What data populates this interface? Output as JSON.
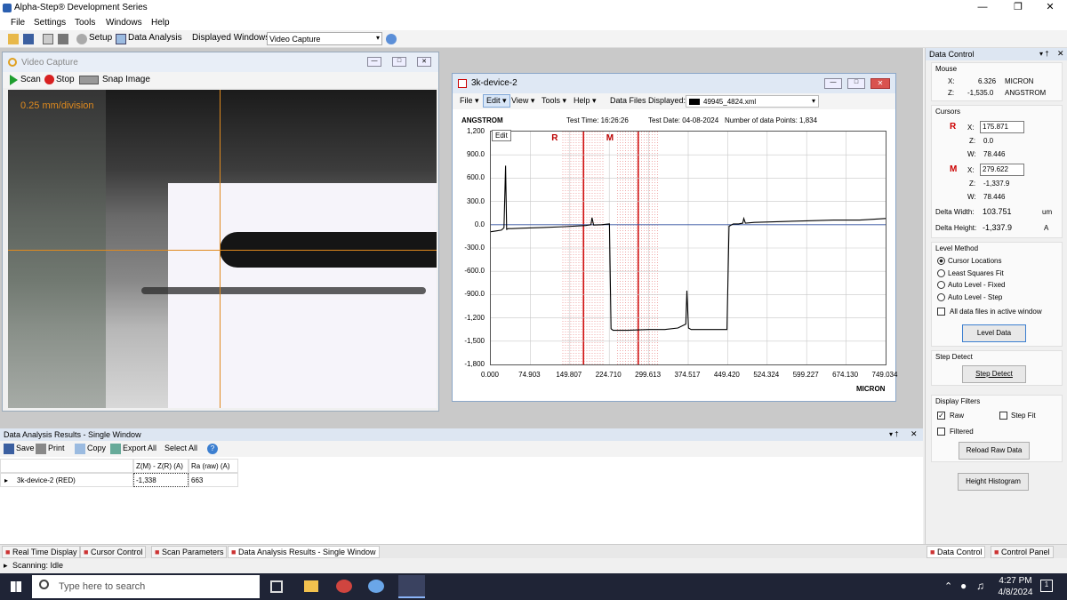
{
  "app": {
    "title": "Alpha-Step® Development Series",
    "menu": [
      "File",
      "Settings",
      "Tools",
      "Windows",
      "Help"
    ]
  },
  "toolbar": {
    "setup": "Setup",
    "data_analysis": "Data Analysis",
    "displayed_windows_label": "Displayed Windows:",
    "displayed_windows_value": "Video Capture"
  },
  "video": {
    "title": "Video Capture",
    "scan": "Scan",
    "stop": "Stop",
    "snap": "Snap Image",
    "scale": "0.25 mm/division"
  },
  "graph": {
    "title": "3k-device-2",
    "menu": [
      "File",
      "Edit",
      "View",
      "Tools",
      "Help"
    ],
    "data_files_label": "Data Files Displayed:",
    "data_file": "49945_4824.xml",
    "y_unit": "ANGSTROM",
    "test_time": "Test Time: 16:26:26",
    "test_date": "Test Date: 04-08-2024",
    "num_points": "Number of data Points: 1,834",
    "tooltip": "Edit",
    "cursor_r_label": "R",
    "cursor_m_label": "M",
    "x_unit": "MICRON"
  },
  "chart_data": {
    "type": "line",
    "xlabel": "MICRON",
    "ylabel": "ANGSTROM",
    "xlim": [
      0,
      749.034
    ],
    "ylim": [
      -1800,
      1200
    ],
    "x_ticks": [
      "0.000",
      "74.903",
      "149.807",
      "224.710",
      "299.613",
      "374.517",
      "449.420",
      "524.324",
      "599.227",
      "674.130",
      "749.034"
    ],
    "y_ticks": [
      "1,200",
      "900.0",
      "600.0",
      "300.0",
      "0.0",
      "-300.0",
      "-600.0",
      "-900.0",
      "-1,200",
      "-1,500",
      "-1,800"
    ],
    "cursors": [
      {
        "name": "R",
        "x": 175.871,
        "width": 78.446
      },
      {
        "name": "M",
        "x": 279.622,
        "width": 78.446
      }
    ],
    "series": [
      {
        "x": [
          0,
          10,
          20,
          25,
          28,
          30,
          33,
          40,
          60,
          100,
          140,
          180,
          190,
          192,
          195,
          210,
          225,
          228,
          232,
          240,
          260,
          300,
          330,
          355,
          370,
          372,
          375,
          380,
          400,
          430,
          448,
          452,
          460,
          470,
          478,
          480,
          483,
          500,
          550,
          600,
          650,
          700,
          749
        ],
        "y": [
          -90,
          -80,
          -70,
          -40,
          760,
          -60,
          -50,
          -50,
          -45,
          -35,
          -25,
          -10,
          0,
          90,
          -5,
          0,
          10,
          -1340,
          -1360,
          -1360,
          -1360,
          -1350,
          -1350,
          -1330,
          -1280,
          -850,
          -1330,
          -1350,
          -1350,
          -1350,
          -1350,
          -20,
          10,
          10,
          20,
          80,
          20,
          30,
          40,
          50,
          60,
          60,
          80
        ]
      }
    ]
  },
  "data_control": {
    "title": "Data Control",
    "mouse": {
      "label": "Mouse",
      "x_label": "X:",
      "x": "6.326",
      "x_unit": "MICRON",
      "z_label": "Z:",
      "z": "-1,535.0",
      "z_unit": "ANGSTROM"
    },
    "cursors_label": "Cursors",
    "r": {
      "label": "R",
      "x_label": "X:",
      "x": "175.871",
      "z_label": "Z:",
      "z": "0.0",
      "w_label": "W:",
      "w": "78.446"
    },
    "m": {
      "label": "M",
      "x_label": "X:",
      "x": "279.622",
      "z_label": "Z:",
      "z": "-1,337.9",
      "w_label": "W:",
      "w": "78.446"
    },
    "delta_width_label": "Delta Width:",
    "delta_width": "103.751",
    "delta_width_unit": "um",
    "delta_height_label": "Delta Height:",
    "delta_height": "-1,337.9",
    "delta_height_unit": "A",
    "level_method_label": "Level Method",
    "level_methods": [
      "Cursor Locations",
      "Least Squares Fit",
      "Auto Level - Fixed",
      "Auto Level - Step"
    ],
    "all_files": "All data files in active window",
    "level_data": "Level Data",
    "step_detect_label": "Step Detect",
    "step_detect": "Step Detect",
    "display_filters_label": "Display Filters",
    "raw": "Raw",
    "step_fit": "Step Fit",
    "filtered": "Filtered",
    "reload": "Reload Raw Data",
    "histogram": "Height Histogram"
  },
  "results": {
    "title": "Data Analysis Results - Single Window",
    "save": "Save",
    "print": "Print",
    "copy": "Copy",
    "export_all": "Export All",
    "select_all": "Select All",
    "col1": "Z(M) - Z(R) (A)",
    "col2": "Ra (raw) (A)",
    "row_name": "3k-device-2 (RED)",
    "row_v1": "-1,338",
    "row_v2": "663"
  },
  "tabs": {
    "bottom": [
      "Real Time Display",
      "Cursor Control",
      "Scan Parameters",
      "Data Analysis Results - Single Window"
    ],
    "right": [
      "Data Control",
      "Control Panel"
    ]
  },
  "status": "Scanning: Idle",
  "taskbar": {
    "search": "Type here to search",
    "time": "4:27 PM",
    "date": "4/8/2024"
  }
}
